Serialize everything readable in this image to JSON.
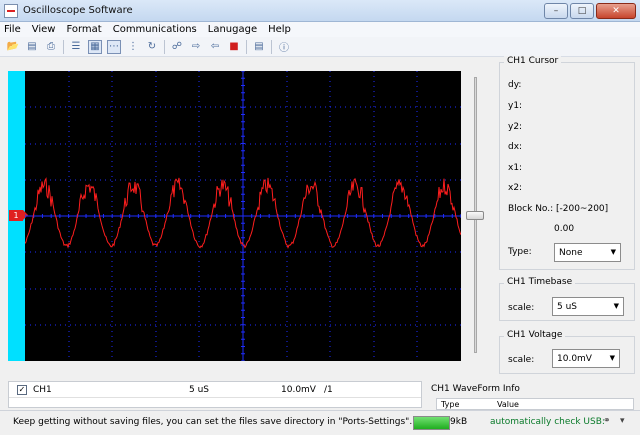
{
  "window": {
    "title": "Oscilloscope Software"
  },
  "menu": [
    "File",
    "View",
    "Format",
    "Communications",
    "Lanugage",
    "Help"
  ],
  "toolbar_icons": [
    "open-folder-icon",
    "save-icon",
    "print-icon",
    "list-icon",
    "grid-icon",
    "dash-line-icon",
    "points-icon",
    "refresh-icon",
    "connect-icon",
    "import-icon",
    "export-icon",
    "stop-icon",
    "screenshot-icon",
    "help-icon"
  ],
  "scope": {
    "channel_marker": "1",
    "trace_color": "#ff1e1e",
    "grid_color": "#1e2dff",
    "side_bar_color": "#00e0ff"
  },
  "cursor": {
    "title": "CH1 Cursor",
    "dy": "dy:",
    "y1": "y1:",
    "y2": "y2:",
    "dx": "dx:",
    "x1": "x1:",
    "x2": "x2:",
    "block_label": "Block No.:",
    "block_range": "[-200~200]",
    "block_value": "0.00",
    "type_label": "Type:",
    "type_value": "None"
  },
  "timebase": {
    "title": "CH1 Timebase",
    "scale_label": "scale:",
    "scale_value": "5  uS"
  },
  "voltage": {
    "title": "CH1 Voltage",
    "scale_label": "scale:",
    "scale_value": "10.0mV"
  },
  "channel_row": {
    "checked": "✓",
    "name": "CH1",
    "time": "5  uS",
    "volt": "10.0mV",
    "probe": "/1"
  },
  "waveform_info": {
    "title": "CH1 WaveForm Info",
    "col_type": "Type",
    "col_value": "Value"
  },
  "status": {
    "message": "Keep getting without saving files, you can set the files save directory in \"Ports-Settings\".",
    "size": "9kB",
    "progress": 1.0,
    "usb": "automatically check USB:"
  }
}
